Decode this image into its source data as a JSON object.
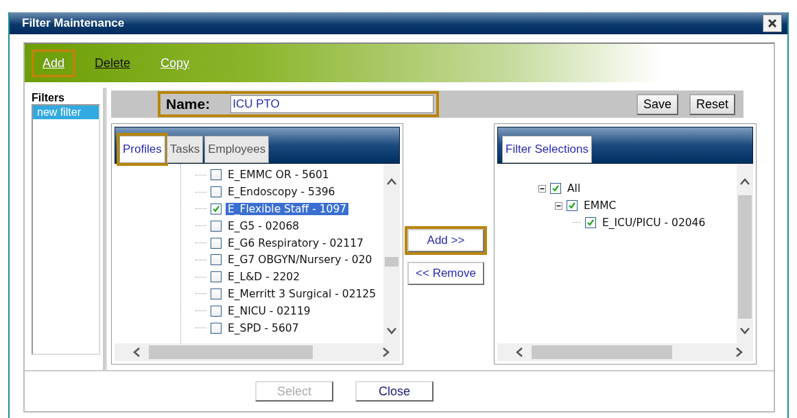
{
  "window": {
    "title": "Filter Maintenance"
  },
  "toolbar": [
    {
      "label": "Add",
      "disabled": true,
      "highlighted": true
    },
    {
      "label": "Delete",
      "disabled": false,
      "highlighted": false
    },
    {
      "label": "Copy",
      "disabled": true,
      "highlighted": false
    }
  ],
  "filters": {
    "heading": "Filters",
    "items": [
      {
        "label": "new filter",
        "selected": true
      }
    ]
  },
  "name_bar": {
    "label": "Name:",
    "value": "ICU PTO",
    "highlighted": true,
    "buttons": [
      "Save",
      "Reset"
    ]
  },
  "source_panel": {
    "tabs": [
      {
        "label": "Profiles",
        "selected": true,
        "highlighted": true
      },
      {
        "label": "Tasks",
        "selected": false,
        "highlighted": false
      },
      {
        "label": "Employees",
        "selected": false,
        "highlighted": false
      }
    ],
    "items": [
      {
        "label": "E_EMMC OR - 5601",
        "checked": false,
        "selected": false
      },
      {
        "label": "E_Endoscopy - 5396",
        "checked": false,
        "selected": false
      },
      {
        "label": "E_Flexible Staff - 1097",
        "checked": true,
        "selected": true
      },
      {
        "label": "E_G5 - 02068",
        "checked": false,
        "selected": false
      },
      {
        "label": "E_G6 Respiratory - 02117",
        "checked": false,
        "selected": false
      },
      {
        "label": "E_G7 OBGYN/Nursery - 020",
        "checked": false,
        "selected": false
      },
      {
        "label": "E_L&D - 2202",
        "checked": false,
        "selected": false
      },
      {
        "label": "E_Merritt 3 Surgical - 02125",
        "checked": false,
        "selected": false
      },
      {
        "label": "E_NICU - 02119",
        "checked": false,
        "selected": false
      },
      {
        "label": "E_SPD - 5607",
        "checked": false,
        "selected": false
      }
    ]
  },
  "move_buttons": [
    {
      "label": "Add >>",
      "highlighted": true
    },
    {
      "label": "<< Remove",
      "highlighted": false
    }
  ],
  "selection_panel": {
    "tabs": [
      {
        "label": "Filter Selections",
        "selected": true
      }
    ],
    "tree": [
      {
        "label": "All",
        "checked": true,
        "expanded": true,
        "children": [
          {
            "label": "EMMC",
            "checked": true,
            "expanded": true,
            "children": [
              {
                "label": "E_ICU/PICU - 02046",
                "checked": true
              }
            ]
          }
        ]
      }
    ]
  },
  "footer_buttons": [
    {
      "label": "Select",
      "disabled": true
    },
    {
      "label": "Close",
      "disabled": false
    }
  ]
}
